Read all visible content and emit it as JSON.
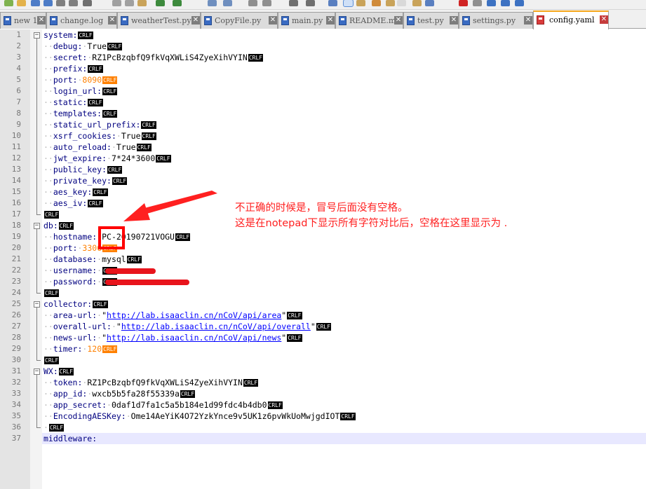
{
  "toolbar": {
    "icons": [
      "new-file-icon",
      "open-file-icon",
      "save-icon",
      "save-all-icon",
      "close-icon",
      "close-all-icon",
      "print-icon",
      "cut-icon",
      "copy-icon",
      "paste-icon",
      "undo-icon",
      "redo-icon",
      "find-icon",
      "replace-icon",
      "zoom-in-icon",
      "zoom-out-icon",
      "sync-v-icon",
      "sync-h-icon",
      "wrap-icon",
      "show-all-chars-icon",
      "indent-guide-icon",
      "lang-icon",
      "doc-map-icon",
      "func-list-icon",
      "folder-icon",
      "monitor-icon",
      "record-icon",
      "stop-icon",
      "play-icon",
      "play-multi-icon",
      "save-macro-icon"
    ]
  },
  "tabs": [
    {
      "label": "new 1",
      "active": false
    },
    {
      "label": "change.log",
      "active": false
    },
    {
      "label": "weatherTest.py",
      "active": false
    },
    {
      "label": "CopyFile.py",
      "active": false
    },
    {
      "label": "main.py",
      "active": false
    },
    {
      "label": "README.md",
      "active": false
    },
    {
      "label": "test.py",
      "active": false
    },
    {
      "label": "settings.py",
      "active": false
    },
    {
      "label": "config.yaml",
      "active": true
    }
  ],
  "eol": "CRLF",
  "lines": [
    {
      "n": "1",
      "key": "system:",
      "val": ""
    },
    {
      "n": "2",
      "key": "debug:",
      "val": "True"
    },
    {
      "n": "3",
      "key": "secret:",
      "val": "RZ1PcBzqbfQ9fkVqXWLiS4ZyeXihVYIN"
    },
    {
      "n": "4",
      "key": "prefix:",
      "val": ""
    },
    {
      "n": "5",
      "key": "port:",
      "val": "8090"
    },
    {
      "n": "6",
      "key": "login_url:",
      "val": ""
    },
    {
      "n": "7",
      "key": "static:",
      "val": ""
    },
    {
      "n": "8",
      "key": "templates:",
      "val": ""
    },
    {
      "n": "9",
      "key": "static_url_prefix:",
      "val": ""
    },
    {
      "n": "10",
      "key": "xsrf_cookies:",
      "val": "True"
    },
    {
      "n": "11",
      "key": "auto_reload:",
      "val": "True"
    },
    {
      "n": "12",
      "key": "jwt_expire:",
      "val": "7*24*3600"
    },
    {
      "n": "13",
      "key": "public_key:",
      "val": ""
    },
    {
      "n": "14",
      "key": "private_key:",
      "val": ""
    },
    {
      "n": "15",
      "key": "aes_key:",
      "val": ""
    },
    {
      "n": "16",
      "key": "aes_iv:",
      "val": ""
    },
    {
      "n": "17",
      "key": "",
      "val": ""
    },
    {
      "n": "18",
      "key": "db:",
      "val": ""
    },
    {
      "n": "19",
      "key": "hostname:",
      "val": "PC-20190721VOGU"
    },
    {
      "n": "20",
      "key": "port:",
      "val": "3306"
    },
    {
      "n": "21",
      "key": "database:",
      "val": "mysql"
    },
    {
      "n": "22",
      "key": "username:",
      "val": ""
    },
    {
      "n": "23",
      "key": "password:",
      "val": ""
    },
    {
      "n": "24",
      "key": "",
      "val": ""
    },
    {
      "n": "25",
      "key": "collector:",
      "val": ""
    },
    {
      "n": "26",
      "key": "area-url:",
      "val": "http://lab.isaaclin.cn/nCoV/api/area"
    },
    {
      "n": "27",
      "key": "overall-url:",
      "val": "http://lab.isaaclin.cn/nCoV/api/overall"
    },
    {
      "n": "28",
      "key": "news-url:",
      "val": "http://lab.isaaclin.cn/nCoV/api/news"
    },
    {
      "n": "29",
      "key": "timer:",
      "val": "120"
    },
    {
      "n": "30",
      "key": "",
      "val": ""
    },
    {
      "n": "31",
      "key": "WX:",
      "val": ""
    },
    {
      "n": "32",
      "key": "token:",
      "val": "RZ1PcBzqbfQ9fkVqXWLiS4ZyeXihVYIN"
    },
    {
      "n": "33",
      "key": "app_id:",
      "val": "wxcb5b5fa28f55339a"
    },
    {
      "n": "34",
      "key": "app_secret:",
      "val": "0daf1d7fa1c5a5b184e1d99fdc4b4db0"
    },
    {
      "n": "35",
      "key": "EncodingAESKey:",
      "val": "Ome14AeYiK4O72YzkYnce9v5UK1z6pvWkUoMwjgdIOT"
    },
    {
      "n": "36",
      "key": "",
      "val": ""
    },
    {
      "n": "37",
      "key": "middleware:",
      "val": ""
    }
  ],
  "annotation": {
    "line1": "不正确的时候是，冒号后面没有空格。",
    "line2": "这是在notepad下显示所有字符对比后，空格在这里显示为 ."
  },
  "colors": {
    "key": "#000080",
    "number": "#ff8000",
    "url": "#0000ff",
    "annotation": "#ff2020",
    "current_line": "#e8e8ff"
  }
}
